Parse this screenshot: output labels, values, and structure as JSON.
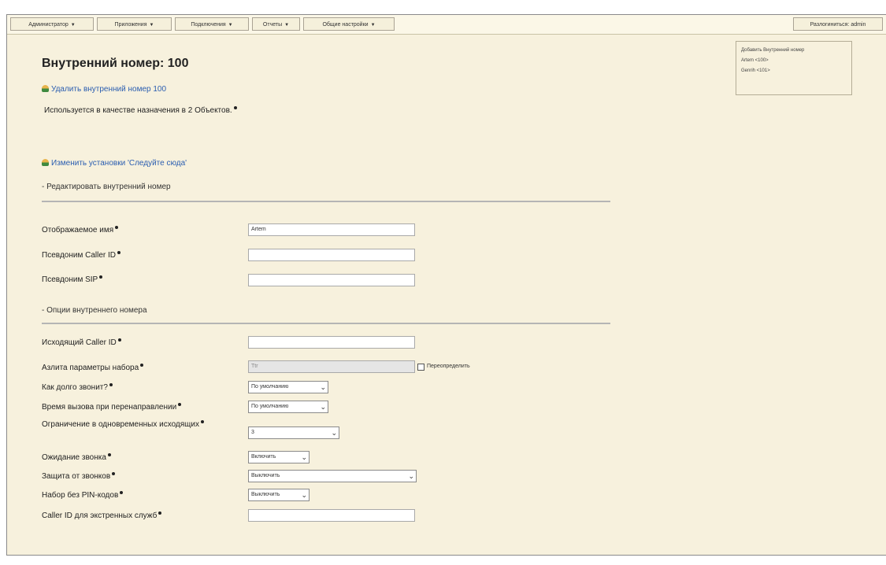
{
  "menu": {
    "items": [
      {
        "label": "Администратор"
      },
      {
        "label": "Приложения"
      },
      {
        "label": "Подключения"
      },
      {
        "label": "Отчеты"
      },
      {
        "label": "Общие настройки"
      }
    ],
    "logout_label": "Разлогиниться: admin"
  },
  "page": {
    "title": "Внутренний номер: 100",
    "delete_link": "Удалить внутренний номер 100",
    "used_text": "Используется в качестве назначения в 2 Объектов.",
    "change_link": "Изменить установки 'Следуйте сюда'"
  },
  "sections": {
    "edit_title": "- Редактировать внутренний номер",
    "options_title": "- Опции внутреннего номера"
  },
  "fields": {
    "display_name": {
      "label": "Отображаемое имя",
      "value": "Artem"
    },
    "callerid_alias": {
      "label": "Псевдоним Caller ID",
      "value": ""
    },
    "sip_alias": {
      "label": "Псевдоним SIP",
      "value": ""
    },
    "outbound_cid": {
      "label": "Исходящий Caller ID",
      "value": ""
    },
    "dial_params": {
      "label": "Азлита параметры набора",
      "value": "Ttr",
      "override_label": "Переопределить"
    },
    "ring_time": {
      "label": "Как долго звонит?",
      "value": "По умолчанию"
    },
    "forward_ring_time": {
      "label": "Время вызова при перенаправлении",
      "value": "По умолчанию"
    },
    "outbound_limit": {
      "label": "Ограничение в одновременных исходящих",
      "value": "3"
    },
    "call_waiting": {
      "label": "Ожидание звонка",
      "value": "Включить"
    },
    "call_screening": {
      "label": "Защита от звонков",
      "value": "Выключить"
    },
    "pinless_dialing": {
      "label": "Набор без PIN-кодов",
      "value": "Выключить"
    },
    "emergency_cid": {
      "label": "Caller ID для экстренных служб",
      "value": ""
    }
  },
  "sidebar": {
    "add_link": "Добавить Внутренний номер",
    "extensions": [
      "Artem <100>",
      "Genrih <101>"
    ]
  }
}
